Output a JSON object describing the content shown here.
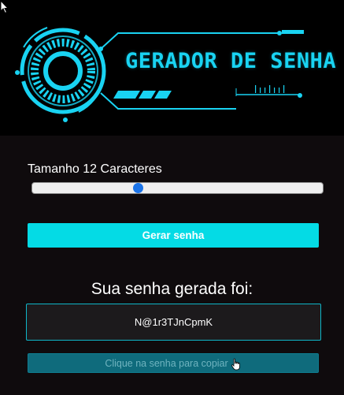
{
  "header": {
    "title": "GERADOR DE SENHA",
    "accent_color": "#19d3f2"
  },
  "length": {
    "label_prefix": "Tamanho",
    "value": 12,
    "label_suffix": "Caracteres",
    "slider_fraction": 0.36
  },
  "generate_button": {
    "label": "Gerar senha",
    "color": "#04dbe5"
  },
  "result": {
    "heading": "Sua senha gerada foi:",
    "password": "N@1r3TJnCpmK"
  },
  "copy_button": {
    "label": "Clique na senha para copiar",
    "icon": "hand-pointer-icon"
  }
}
